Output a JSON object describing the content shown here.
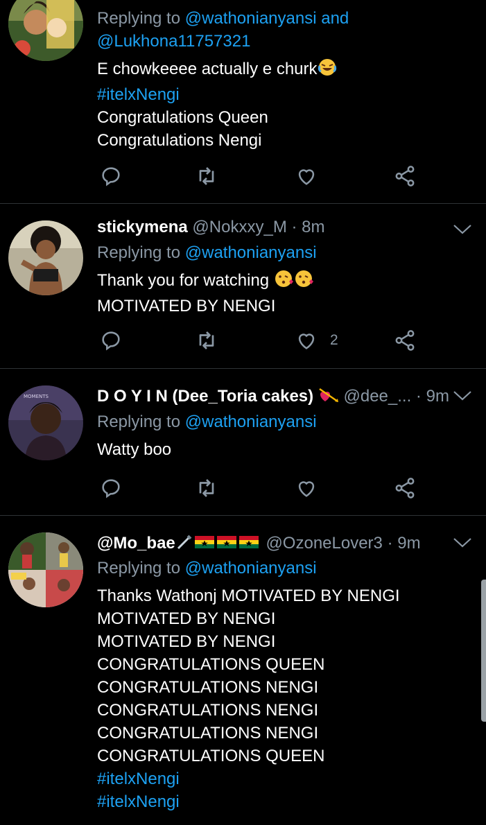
{
  "tweets": [
    {
      "reply_prefix": "Replying to",
      "mentions": [
        "@wathonianyansi",
        "and",
        "@Lukhona11757321"
      ],
      "lines": [
        "E chowkeeee actually e churk"
      ],
      "hashtag": "#itelxNengi",
      "lines_after": [
        "Congratulations Queen",
        "Congratulations Nengi"
      ],
      "emoji": "face-with-tears-of-joy"
    },
    {
      "name": "stickymena",
      "handle": "@Nokxxy_M",
      "dot": "·",
      "time": "8m",
      "reply_prefix": "Replying to",
      "mention": "@wathonianyansi",
      "lines": [
        "Thank you for watching",
        "MOTIVATED BY NENGI"
      ],
      "emoji": "face-blowing-kiss",
      "like_count": "2"
    },
    {
      "name": "D O Y I N (Dee_Toria cakes)",
      "handle": "@dee_...",
      "dot": "·",
      "time": "9m",
      "reply_prefix": "Replying to",
      "mention": "@wathonianyansi",
      "lines": [
        "Watty boo"
      ],
      "emoji": "heart-with-arrow"
    },
    {
      "name": "@Mo_bae",
      "handle": "@OzoneLover3",
      "dot": "·",
      "time": "9m",
      "reply_prefix": "Replying to",
      "mention": "@wathonianyansi",
      "lines": [
        "Thanks Wathonj MOTIVATED BY NENGI",
        "MOTIVATED BY NENGI",
        "MOTIVATED BY NENGI",
        "CONGRATULATIONS QUEEN",
        "CONGRATULATIONS NENGI",
        "CONGRATULATIONS NENGI",
        "CONGRATULATIONS NENGI",
        "CONGRATULATIONS QUEEN"
      ],
      "hashtags": [
        "#itelxNengi",
        "#itelxNengi"
      ],
      "emoji": "dagger-and-ghana-flags"
    }
  ],
  "colors": {
    "background": "#000000",
    "text": "#ffffff",
    "muted": "#8b98a5",
    "link": "#1da1f2",
    "divider": "#2f3336"
  },
  "icons": [
    "reply-icon",
    "retweet-icon",
    "like-icon",
    "share-icon",
    "chevron-down-icon"
  ]
}
